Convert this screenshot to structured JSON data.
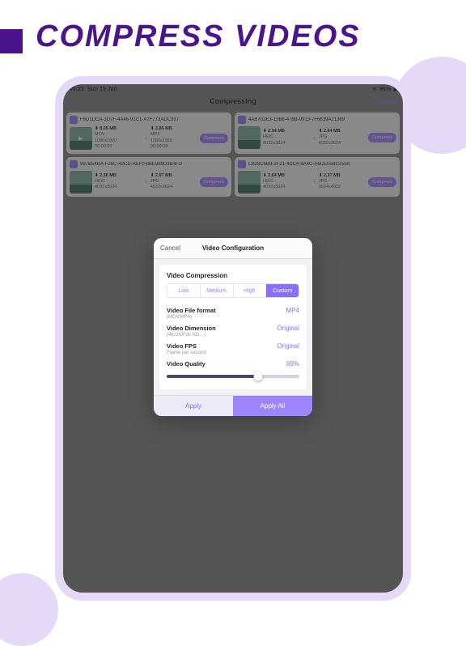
{
  "hero": {
    "title": "COMPRESS VIDEOS"
  },
  "statusbar": {
    "time": "00:23",
    "date": "Sun 15 Jan",
    "battery": "96%"
  },
  "nav": {
    "title": "Compressing",
    "action": "Start All"
  },
  "items": [
    {
      "name": "F6D1DCA-3D7F-4A46-91C1-A7F773ADC337",
      "src": {
        "size": "8.05 MB",
        "format": "MOV",
        "dim": "1080x1920",
        "dur": "00:00:09"
      },
      "dst": {
        "size": "2.85 MB",
        "format": "MP4",
        "dim": "1080x1920",
        "dur": "00:00:09"
      },
      "button": "Compress",
      "is_video": true
    },
    {
      "name": "4AB702E3-13B8-476B-9913-7F6839A21389",
      "src": {
        "size": "2.94 MB",
        "format": "HEIC",
        "dim": "4032x3024"
      },
      "dst": {
        "size": "2.64 MB",
        "format": "JPG",
        "dim": "4032x3024"
      },
      "button": "Compress",
      "is_video": false
    },
    {
      "name": "997B54BA-F26C-42CD-AEF0-8BE989D3B4FD",
      "src": {
        "size": "2.30 MB",
        "format": "HEIC",
        "dim": "4032x3024"
      },
      "dst": {
        "size": "2.07 MB",
        "format": "JPG",
        "dim": "4032x3024"
      },
      "button": "Compress",
      "is_video": false
    },
    {
      "name": "C828C6B9-2F21-4DC4-8A4C-A6CE05BC2556",
      "src": {
        "size": "2.64 MB",
        "format": "HEIC",
        "dim": "4032x3024"
      },
      "dst": {
        "size": "2.37 MB",
        "format": "JPG",
        "dim": "3024x4032"
      },
      "button": "Compress",
      "is_video": false
    }
  ],
  "sheet": {
    "cancel": "Cancel",
    "title": "Video Configuration",
    "section_label": "Video Compression",
    "seg": [
      "Low",
      "Medium",
      "High",
      "Custom"
    ],
    "seg_active": 3,
    "rows": {
      "format": {
        "label": "Video File format",
        "sub": "(MOV,MP4)",
        "value": "MP4"
      },
      "dimension": {
        "label": "Video Dimension",
        "sub": "(4K/2K/Full HD…)",
        "value": "Original"
      },
      "fps": {
        "label": "Video FPS",
        "sub": "Frame per second",
        "value": "Original"
      },
      "quality": {
        "label": "Video Quality",
        "value": "69%"
      }
    },
    "apply": "Apply",
    "apply_all": "Apply All"
  }
}
